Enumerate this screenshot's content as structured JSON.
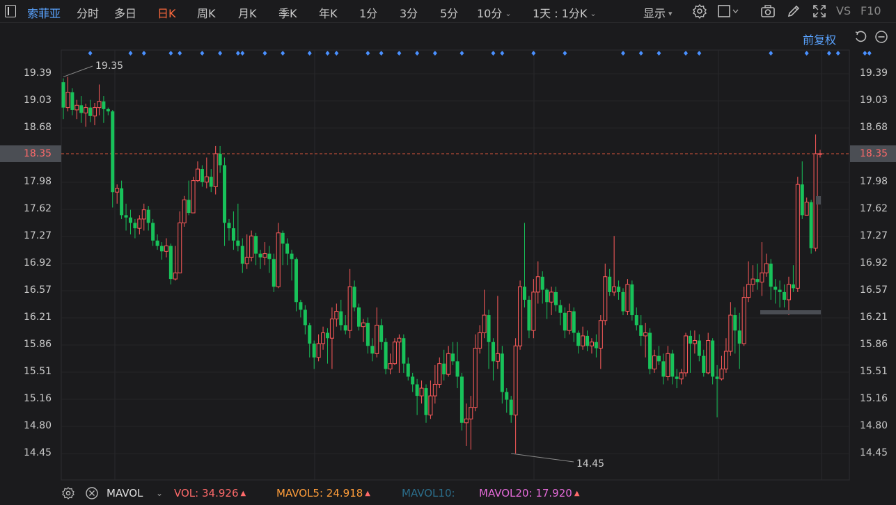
{
  "toolbar": {
    "stock_name": "索菲亚",
    "periods": [
      "分时",
      "多日",
      "日K",
      "周K",
      "月K",
      "季K",
      "年K",
      "1分",
      "3分",
      "5分",
      "10分"
    ],
    "active_period": "日K",
    "interval_select": "1天 : 1分K",
    "display_label": "显示",
    "vs_label": "VS",
    "f10_label": "F10",
    "icons": [
      "settings-icon",
      "layout-icon",
      "camera-icon",
      "draw-icon",
      "fullscreen-icon"
    ]
  },
  "sub_toolbar": {
    "adjust_label": "前复权",
    "icons": [
      "rewind-icon",
      "minus-icon"
    ]
  },
  "axis": {
    "labels": [
      "19.39",
      "19.03",
      "18.68",
      "18.35",
      "17.98",
      "17.62",
      "17.27",
      "16.92",
      "16.57",
      "16.21",
      "15.86",
      "15.51",
      "15.16",
      "14.80",
      "14.45"
    ],
    "current_price": "18.35"
  },
  "annotations": {
    "high_label": "19.35",
    "low_label": "14.45"
  },
  "indicator_bar": {
    "name": "MAVOL",
    "vol_label": "VOL:",
    "vol_value": "34.926",
    "mavol5_label": "MAVOL5:",
    "mavol5_value": "24.918",
    "mavol10_label": "MAVOL10:",
    "mavol20_label": "MAVOL20:",
    "mavol20_value": "17.920",
    "icons": [
      "settings-icon",
      "close-icon",
      "chevron-down-icon"
    ]
  },
  "colors": {
    "up": "#ff5b5b",
    "down": "#18c25a",
    "accent": "#ff6a3d",
    "link": "#5aa3ff",
    "mavol5": "#ff9d3a",
    "mavol10": "#2b6d8a",
    "mavol20": "#e46ad8"
  },
  "chart_data": {
    "type": "candlestick",
    "y_range": [
      14.45,
      19.39
    ],
    "candles": [
      [
        19.28,
        18.95,
        19.33,
        18.8
      ],
      [
        18.95,
        19.15,
        19.35,
        18.9
      ],
      [
        19.15,
        18.92,
        19.2,
        18.85
      ],
      [
        18.92,
        18.98,
        19.05,
        18.8
      ],
      [
        18.98,
        18.88,
        19.1,
        18.75
      ],
      [
        18.88,
        18.95,
        19.0,
        18.7
      ],
      [
        18.95,
        18.84,
        19.05,
        18.76
      ],
      [
        18.84,
        18.95,
        19.01,
        18.72
      ],
      [
        18.95,
        19.03,
        19.25,
        18.85
      ],
      [
        19.03,
        18.93,
        19.1,
        18.75
      ],
      [
        18.93,
        18.9,
        18.95,
        18.85
      ],
      [
        18.9,
        17.85,
        18.92,
        17.65
      ],
      [
        17.85,
        17.9,
        17.95,
        17.7
      ],
      [
        17.9,
        17.55,
        18.0,
        17.5
      ],
      [
        17.55,
        17.52,
        17.7,
        17.35
      ],
      [
        17.52,
        17.45,
        17.62,
        17.3
      ],
      [
        17.45,
        17.38,
        17.5,
        17.25
      ],
      [
        17.38,
        17.5,
        17.55,
        17.3
      ],
      [
        17.5,
        17.62,
        17.7,
        17.35
      ],
      [
        17.62,
        17.45,
        17.67,
        17.35
      ],
      [
        17.45,
        17.22,
        17.5,
        17.15
      ],
      [
        17.22,
        17.15,
        17.3,
        17.1
      ],
      [
        17.15,
        17.08,
        17.2,
        16.97
      ],
      [
        17.08,
        17.15,
        17.25,
        17.0
      ],
      [
        17.15,
        16.72,
        17.18,
        16.65
      ],
      [
        16.72,
        16.8,
        17.15,
        16.7
      ],
      [
        16.8,
        17.45,
        17.6,
        16.8
      ],
      [
        17.45,
        17.75,
        17.8,
        17.4
      ],
      [
        17.75,
        17.58,
        18.0,
        17.55
      ],
      [
        17.58,
        18.0,
        18.05,
        17.9
      ],
      [
        18.0,
        18.15,
        18.25,
        17.98
      ],
      [
        18.15,
        17.98,
        18.2,
        17.92
      ],
      [
        17.98,
        18.05,
        18.3,
        17.9
      ],
      [
        18.05,
        17.92,
        18.15,
        17.85
      ],
      [
        17.92,
        18.35,
        18.45,
        17.82
      ],
      [
        18.35,
        18.2,
        18.45,
        18.1
      ],
      [
        18.2,
        17.45,
        18.3,
        17.15
      ],
      [
        17.45,
        17.38,
        17.5,
        17.22
      ],
      [
        17.38,
        17.22,
        17.6,
        17.1
      ],
      [
        17.22,
        17.15,
        17.7,
        17.08
      ],
      [
        17.15,
        16.92,
        17.25,
        16.8
      ],
      [
        16.92,
        17.0,
        17.3,
        16.85
      ],
      [
        17.0,
        17.28,
        17.35,
        16.95
      ],
      [
        17.28,
        17.05,
        17.32,
        16.9
      ],
      [
        17.05,
        17.0,
        17.1,
        16.85
      ],
      [
        17.0,
        17.05,
        17.2,
        16.9
      ],
      [
        17.05,
        16.98,
        17.15,
        16.8
      ],
      [
        16.98,
        16.62,
        17.05,
        16.55
      ],
      [
        16.62,
        17.32,
        17.45,
        16.6
      ],
      [
        17.32,
        17.18,
        17.35,
        16.9
      ],
      [
        17.18,
        17.05,
        17.25,
        16.9
      ],
      [
        17.05,
        16.98,
        17.1,
        16.7
      ],
      [
        16.98,
        16.42,
        17.0,
        16.3
      ],
      [
        16.42,
        16.32,
        16.45,
        16.22
      ],
      [
        16.32,
        16.12,
        16.38,
        16.0
      ],
      [
        16.12,
        15.88,
        16.15,
        15.7
      ],
      [
        15.88,
        15.7,
        15.92,
        15.55
      ],
      [
        15.7,
        15.88,
        16.0,
        15.65
      ],
      [
        15.88,
        16.02,
        16.1,
        15.8
      ],
      [
        16.02,
        15.95,
        16.08,
        15.62
      ],
      [
        15.95,
        16.2,
        16.35,
        15.55
      ],
      [
        16.2,
        16.3,
        16.4,
        16.1
      ],
      [
        16.3,
        16.12,
        16.45,
        16.05
      ],
      [
        16.12,
        16.05,
        16.25,
        16.0
      ],
      [
        16.05,
        16.62,
        16.85,
        15.95
      ],
      [
        16.62,
        16.35,
        16.7,
        16.3
      ],
      [
        16.35,
        16.1,
        16.4,
        16.05
      ],
      [
        16.1,
        16.15,
        16.2,
        15.9
      ],
      [
        16.15,
        15.85,
        16.22,
        15.75
      ],
      [
        15.85,
        15.75,
        15.95,
        15.65
      ],
      [
        15.75,
        16.12,
        16.35,
        15.7
      ],
      [
        16.12,
        15.9,
        16.2,
        15.8
      ],
      [
        15.9,
        15.55,
        15.95,
        15.48
      ],
      [
        15.55,
        15.62,
        15.75,
        15.48
      ],
      [
        15.62,
        15.9,
        15.95,
        15.6
      ],
      [
        15.9,
        15.95,
        16.0,
        15.5
      ],
      [
        15.95,
        15.62,
        16.0,
        15.5
      ],
      [
        15.62,
        15.45,
        15.7,
        15.4
      ],
      [
        15.45,
        15.35,
        15.5,
        15.25
      ],
      [
        15.35,
        15.2,
        15.42,
        14.95
      ],
      [
        15.2,
        15.3,
        15.4,
        15.1
      ],
      [
        15.3,
        14.95,
        15.35,
        14.85
      ],
      [
        14.95,
        15.2,
        15.4,
        14.9
      ],
      [
        15.2,
        15.35,
        15.6,
        15.1
      ],
      [
        15.35,
        15.62,
        15.7,
        15.3
      ],
      [
        15.62,
        15.48,
        15.8,
        15.4
      ],
      [
        15.48,
        15.75,
        15.85,
        15.45
      ],
      [
        15.75,
        15.65,
        15.9,
        15.6
      ],
      [
        15.65,
        15.45,
        15.9,
        15.3
      ],
      [
        15.45,
        14.85,
        15.5,
        14.75
      ],
      [
        14.85,
        14.9,
        15.1,
        14.55
      ],
      [
        14.9,
        15.05,
        15.2,
        14.5
      ],
      [
        15.05,
        15.82,
        16.0,
        15.0
      ],
      [
        15.82,
        16.02,
        16.12,
        15.75
      ],
      [
        16.02,
        16.25,
        16.58,
        15.95
      ],
      [
        16.25,
        15.9,
        16.32,
        15.55
      ],
      [
        15.9,
        15.65,
        15.95,
        15.4
      ],
      [
        15.65,
        15.75,
        16.5,
        15.55
      ],
      [
        15.75,
        15.25,
        15.85,
        15.1
      ],
      [
        15.25,
        15.15,
        15.3,
        14.98
      ],
      [
        15.15,
        14.95,
        15.2,
        14.85
      ],
      [
        14.95,
        15.85,
        15.95,
        14.45
      ],
      [
        15.85,
        16.62,
        16.7,
        15.8
      ],
      [
        16.62,
        16.45,
        17.45,
        16.35
      ],
      [
        16.45,
        16.05,
        16.5,
        15.95
      ],
      [
        16.05,
        16.55,
        16.72,
        15.95
      ],
      [
        16.55,
        16.75,
        16.95,
        16.4
      ],
      [
        16.75,
        16.58,
        16.82,
        16.4
      ],
      [
        16.58,
        16.42,
        16.6,
        16.2
      ],
      [
        16.42,
        16.55,
        16.62,
        16.25
      ],
      [
        16.55,
        16.38,
        16.62,
        16.3
      ],
      [
        16.38,
        16.28,
        16.45,
        16.12
      ],
      [
        16.28,
        16.05,
        16.35,
        15.95
      ],
      [
        16.05,
        16.3,
        16.4,
        16.0
      ],
      [
        16.3,
        16.02,
        16.35,
        15.9
      ],
      [
        16.02,
        15.85,
        16.05,
        15.75
      ],
      [
        15.85,
        15.98,
        16.1,
        15.8
      ],
      [
        15.98,
        15.85,
        16.05,
        15.78
      ],
      [
        15.85,
        15.9,
        15.95,
        15.75
      ],
      [
        15.9,
        15.82,
        16.0,
        15.7
      ],
      [
        15.82,
        16.18,
        16.25,
        15.55
      ],
      [
        16.18,
        16.75,
        16.92,
        16.12
      ],
      [
        16.75,
        16.55,
        16.85,
        16.5
      ],
      [
        16.55,
        16.62,
        17.28,
        16.5
      ],
      [
        16.62,
        16.55,
        16.7,
        16.45
      ],
      [
        16.55,
        16.3,
        16.6,
        16.25
      ],
      [
        16.3,
        16.65,
        16.72,
        16.25
      ],
      [
        16.65,
        16.25,
        16.7,
        16.18
      ],
      [
        16.25,
        16.12,
        16.35,
        16.05
      ],
      [
        16.12,
        15.98,
        16.25,
        15.85
      ],
      [
        15.98,
        16.02,
        16.15,
        15.7
      ],
      [
        16.02,
        15.55,
        16.08,
        15.48
      ],
      [
        15.55,
        15.72,
        15.8,
        15.5
      ],
      [
        15.72,
        15.65,
        15.85,
        15.6
      ],
      [
        15.65,
        15.45,
        15.75,
        15.35
      ],
      [
        15.45,
        15.75,
        15.85,
        15.4
      ],
      [
        15.75,
        15.45,
        15.8,
        15.35
      ],
      [
        15.45,
        15.42,
        15.55,
        15.3
      ],
      [
        15.42,
        15.5,
        15.55,
        15.35
      ],
      [
        15.5,
        15.98,
        16.02,
        15.45
      ],
      [
        15.98,
        15.88,
        16.05,
        15.5
      ],
      [
        15.88,
        15.92,
        16.05,
        15.75
      ],
      [
        15.92,
        15.72,
        16.0,
        15.65
      ],
      [
        15.72,
        15.5,
        15.8,
        15.45
      ],
      [
        15.5,
        15.92,
        16.02,
        15.48
      ],
      [
        15.92,
        15.45,
        15.95,
        15.35
      ],
      [
        15.45,
        15.42,
        15.6,
        14.92
      ],
      [
        15.42,
        15.55,
        15.72,
        15.4
      ],
      [
        15.55,
        15.78,
        15.95,
        15.5
      ],
      [
        15.78,
        16.25,
        16.42,
        15.72
      ],
      [
        16.25,
        16.05,
        16.35,
        15.75
      ],
      [
        16.05,
        15.88,
        16.28,
        15.55
      ],
      [
        15.88,
        16.48,
        16.62,
        15.85
      ],
      [
        16.48,
        16.65,
        16.95,
        16.42
      ],
      [
        16.65,
        16.72,
        16.9,
        16.55
      ],
      [
        16.72,
        16.68,
        16.92,
        16.58
      ],
      [
        16.68,
        16.8,
        17.2,
        16.5
      ],
      [
        16.8,
        16.92,
        17.05,
        16.75
      ],
      [
        16.92,
        16.62,
        16.98,
        16.45
      ],
      [
        16.62,
        16.58,
        16.72,
        16.4
      ],
      [
        16.58,
        16.55,
        16.7,
        16.35
      ],
      [
        16.55,
        16.45,
        16.65,
        16.35
      ],
      [
        16.45,
        16.65,
        16.75,
        16.25
      ],
      [
        16.65,
        16.6,
        16.9,
        16.55
      ],
      [
        16.6,
        17.95,
        18.05,
        16.55
      ],
      [
        17.95,
        17.55,
        18.25,
        17.5
      ],
      [
        17.55,
        17.72,
        17.78,
        17.62
      ],
      [
        17.72,
        17.12,
        17.75,
        17.05
      ],
      [
        17.12,
        18.35,
        18.6,
        17.08
      ],
      [
        18.35,
        18.35,
        18.4,
        18.3
      ]
    ],
    "signal_markers": [
      6,
      15,
      18,
      24,
      26,
      31,
      35,
      39,
      40,
      45,
      49,
      55,
      59,
      61,
      68,
      71,
      75,
      79,
      83,
      89,
      96,
      98,
      105,
      112,
      125,
      129,
      133,
      139,
      142,
      158,
      166,
      171,
      173,
      179,
      180
    ]
  }
}
